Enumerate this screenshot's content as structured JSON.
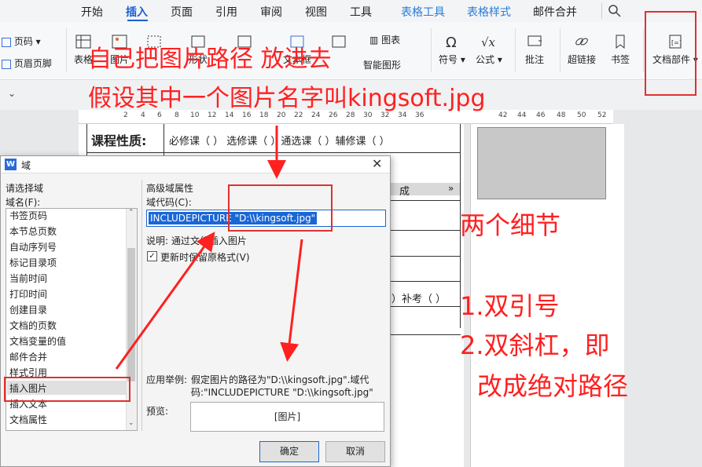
{
  "menubar": {
    "tabs": [
      "开始",
      "插入",
      "页面",
      "引用",
      "审阅",
      "视图",
      "工具",
      "表格工具",
      "表格样式",
      "邮件合并"
    ],
    "active_tab": "插入"
  },
  "ribbon": {
    "page_label": "页码",
    "header_footer_label": "页眉页脚",
    "table_label": "表格",
    "picture_label": "图片",
    "shape_label": "形状",
    "smartart_label": "智能图形",
    "textbox_label": "文本框",
    "chart_label": "图表",
    "symbol_label": "符号",
    "formula_label": "公式",
    "comment_label": "批注",
    "hyperlink_label": "超链接",
    "bookmark_label": "书签",
    "doc_parts_label": "文档部件"
  },
  "ruler": {
    "ticks": [
      "2",
      "4",
      "6",
      "8",
      "10",
      "12",
      "14",
      "16",
      "18",
      "20",
      "22",
      "24",
      "26",
      "28",
      "30",
      "32",
      "34",
      "36"
    ],
    "ticks_right": [
      "42",
      "44",
      "46",
      "48",
      "50",
      "52"
    ]
  },
  "document": {
    "course_nature_label": "课程性质:",
    "course_options": "必修课（ ）  选修课（ ）通选课（ ）辅修课（ ）",
    "cell_text_1": "成",
    "cell_arrow": "»",
    "cell_text_2": "）补考（ ）"
  },
  "dialog": {
    "title": "域",
    "choose_field_label": "请选择域",
    "field_name_label": "域名(F):",
    "field_items": [
      "书签页码",
      "本节总页数",
      "自动序列号",
      "标记目录项",
      "当前时间",
      "打印时间",
      "创建目录",
      "文档的页数",
      "文档变量的值",
      "邮件合并",
      "样式引用",
      "插入图片",
      "插入文本",
      "文档属性"
    ],
    "selected_item": "插入图片",
    "advanced_label": "高级域属性",
    "field_code_label": "域代码(C):",
    "field_code_value": "INCLUDEPICTURE \"D:\\\\kingsoft.jpg\"",
    "description": "说明: 通过文件插入图片",
    "keep_format_label": "更新时保留原格式(V)",
    "example_label": "应用举例:",
    "example_text_1": "假定图片的路径为\"D:\\\\kingsoft.jpg\".域代",
    "example_text_2": "码:\"INCLUDEPICTURE \"D:\\\\kingsoft.jpg\"",
    "preview_label": "预览:",
    "preview_value": "[图片]",
    "ok_label": "确定",
    "cancel_label": "取消"
  },
  "annotations": {
    "line1": "自己把图片路径 放进去",
    "line2": "假设其中一个图片名字叫kingsoft.jpg",
    "details": "两个细节",
    "detail1": "1.双引号",
    "detail2": "2.双斜杠，即",
    "detail3": "改成绝对路径"
  },
  "colors": {
    "accent": "#1a5fd4",
    "annotation": "#ff2020"
  }
}
